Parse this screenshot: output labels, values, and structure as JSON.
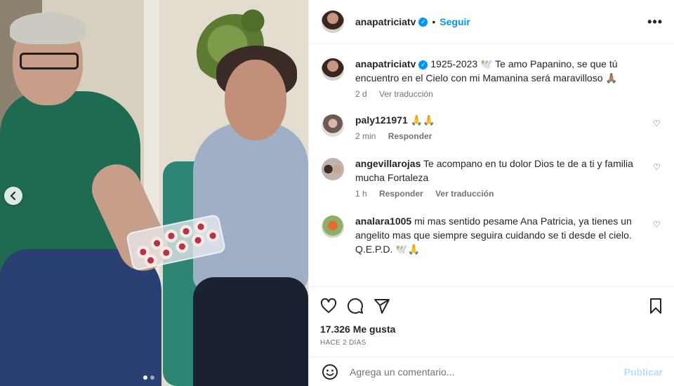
{
  "post": {
    "username": "anapatriciatv",
    "follow_label": "Seguir",
    "bullet": "•",
    "more_icon": "•••"
  },
  "carousel": {
    "prev_icon": "chevron-left-icon",
    "dot_count": 2
  },
  "caption": {
    "username": "anapatriciatv",
    "text": "1925-2023 🕊️ Te amo Papanino, se que tú encuentro en el Cielo con mi Mamanina será maravilloso 🙏🏽",
    "time": "2 d",
    "translate": "Ver traducción"
  },
  "comments": [
    {
      "username": "paly121971",
      "text": "🙏🙏",
      "time": "2 min",
      "reply": "Responder",
      "translate": ""
    },
    {
      "username": "angevillarojas",
      "text": "Te acompano en tu dolor Dios te de a ti y familia mucha Fortaleza",
      "time": "1 h",
      "reply": "Responder",
      "translate": "Ver traducción"
    },
    {
      "username": "analara1005",
      "text": "mi mas sentido pesame Ana Patricia, ya tienes un angelito mas que siempre seguira cuidando se ti desde el cielo. Q.E.P.D. 🕊️🙏",
      "time": "",
      "reply": "",
      "translate": ""
    }
  ],
  "stats": {
    "likes": "17.326 Me gusta",
    "ago": "HACE 2 DÍAS"
  },
  "composer": {
    "placeholder": "Agrega un comentario...",
    "publish": "Publicar"
  },
  "colors": {
    "link": "#0095f6",
    "muted": "#737373",
    "publish_disabled": "#b2dffc"
  }
}
